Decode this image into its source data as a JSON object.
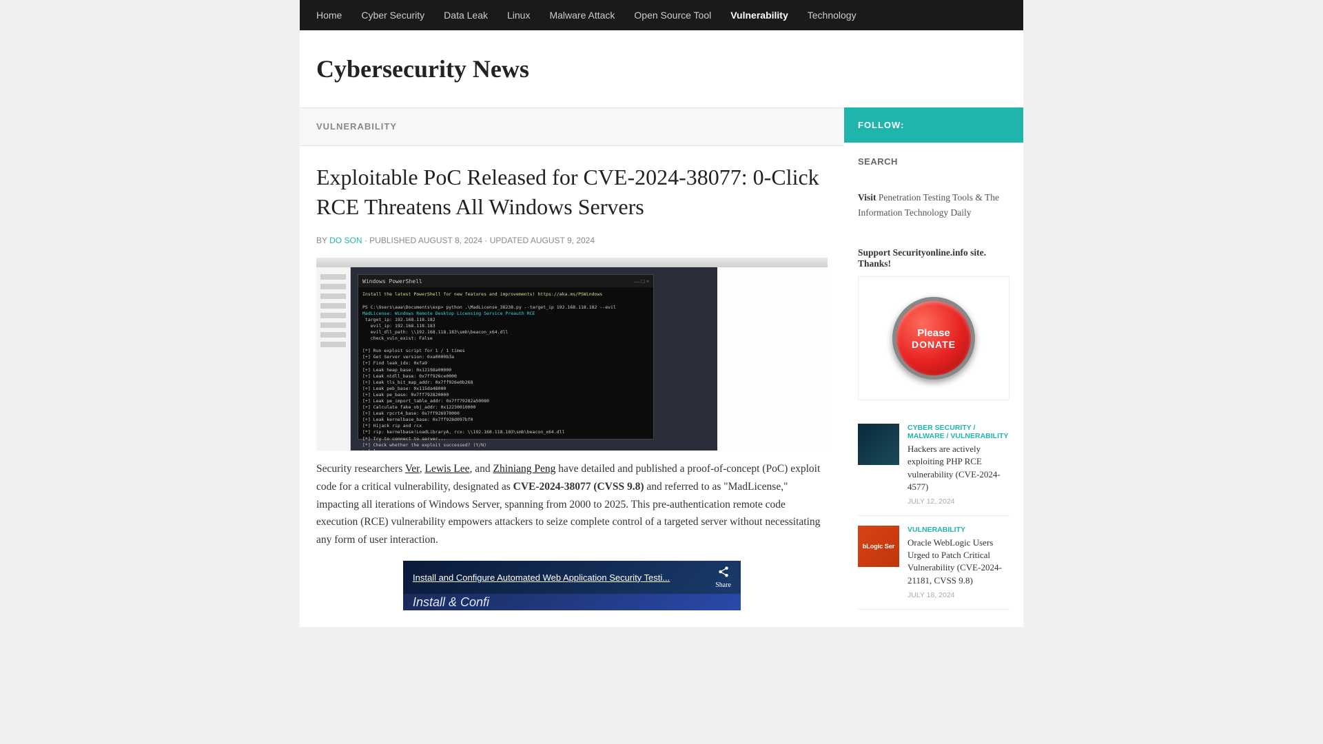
{
  "nav": {
    "items": [
      "Home",
      "Cyber Security",
      "Data Leak",
      "Linux",
      "Malware Attack",
      "Open Source Tool",
      "Vulnerability",
      "Technology"
    ],
    "active_index": 6
  },
  "header": {
    "site_title": "Cybersecurity News"
  },
  "article": {
    "category": "VULNERABILITY",
    "title": "Exploitable PoC Released for CVE-2024-38077: 0-Click RCE Threatens All Windows Servers",
    "by_label": "BY",
    "author": "DO SON",
    "published_label": "PUBLISHED",
    "published_date": "AUGUST 8, 2024",
    "updated_label": "UPDATED",
    "updated_date": "AUGUST 9, 2024",
    "screenshot_terminal_title": "Windows PowerShell",
    "body_p1_prefix": "Security researchers ",
    "link_ver": "Ver",
    "sep1": ", ",
    "link_lewis": "Lewis Lee",
    "sep2": ", and ",
    "link_zhiniang": "Zhiniang Peng",
    "body_p1_mid": " have detailed and published a proof-of-concept (PoC) exploit code for a critical vulnerability, designated as ",
    "cve_bold": "CVE-2024-38077 (CVSS 9.8)",
    "body_p1_suffix": " and referred to as \"MadLicense,\" impacting all iterations of Windows Server, spanning from 2000 to 2025. This pre-authentication remote code execution (RCE) vulnerability empowers attackers to seize complete control of a targeted server without necessitating any form of user interaction."
  },
  "video": {
    "title": "Install and Configure Automated Web Application Security Testi...",
    "share_label": "Share",
    "subtitle": "Install & Confi"
  },
  "sidebar": {
    "follow_label": "FOLLOW:",
    "search_heading": "SEARCH",
    "visit_bold": "Visit",
    "visit_text": " Penetration Testing Tools & The Information Technology Daily",
    "support_text": "Support Securityonline.info site. Thanks!",
    "donate_line1": "Please",
    "donate_line2": "DONATE",
    "related": [
      {
        "cats": "CYBER SECURITY / MALWARE / VULNERABILITY",
        "title": "Hackers are actively exploiting PHP RCE vulnerability (CVE-2024-4577)",
        "date": "JULY 12, 2024",
        "thumb_style": "dark"
      },
      {
        "cats": "VULNERABILITY",
        "title": "Oracle WebLogic Users Urged to Patch Critical Vulnerability (CVE-2024-21181, CVSS 9.8)",
        "date": "JULY 18, 2024",
        "thumb_style": "orange",
        "thumb_text": "bLogic Ser"
      }
    ]
  }
}
